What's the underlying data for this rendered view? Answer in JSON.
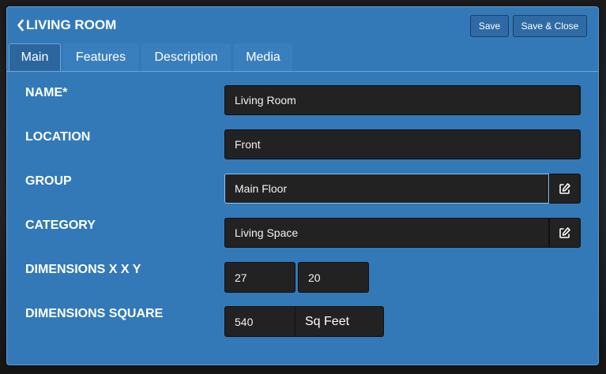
{
  "header": {
    "title": "LIVING ROOM",
    "save_label": "Save",
    "save_close_label": "Save & Close"
  },
  "tabs": [
    {
      "label": "Main",
      "active": true
    },
    {
      "label": "Features",
      "active": false
    },
    {
      "label": "Description",
      "active": false
    },
    {
      "label": "Media",
      "active": false
    }
  ],
  "form": {
    "name": {
      "label": "NAME*",
      "value": "Living Room"
    },
    "location": {
      "label": "LOCATION",
      "value": "Front"
    },
    "group": {
      "label": "GROUP",
      "value": "Main Floor"
    },
    "category": {
      "label": "CATEGORY",
      "value": "Living Space"
    },
    "dimensions_xy": {
      "label": "DIMENSIONS X X Y",
      "x": "27",
      "y": "20"
    },
    "dimensions_square": {
      "label": "DIMENSIONS SQUARE",
      "value": "540",
      "unit": "Sq Feet"
    }
  },
  "icons": {
    "back": "chevron-left-icon",
    "edit": "edit-icon"
  },
  "colors": {
    "dialog_bg": "#3379b8",
    "field_bg": "#222222",
    "text": "#ffffff"
  }
}
